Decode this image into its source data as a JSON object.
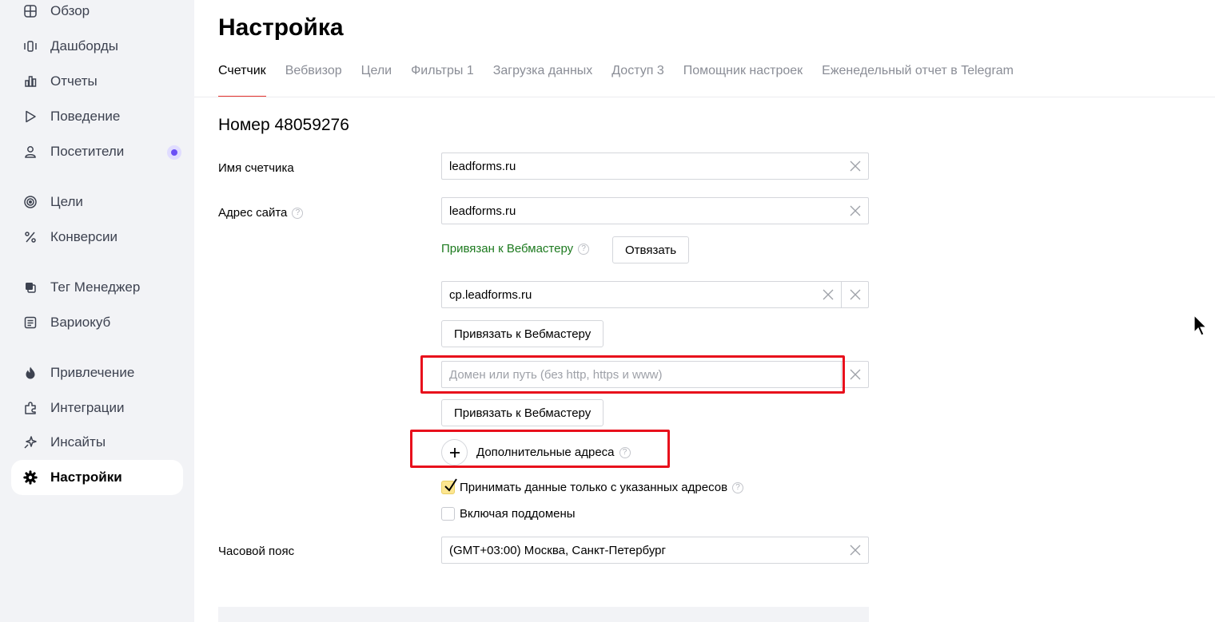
{
  "sidebar": {
    "items": [
      {
        "label": "Обзор",
        "icon": "grid-icon"
      },
      {
        "label": "Дашборды",
        "icon": "dashboards-icon"
      },
      {
        "label": "Отчеты",
        "icon": "bar-chart-icon"
      },
      {
        "label": "Поведение",
        "icon": "play-icon"
      },
      {
        "label": "Посетители",
        "icon": "person-icon"
      },
      {
        "label": "Цели",
        "icon": "target-icon"
      },
      {
        "label": "Конверсии",
        "icon": "percent-icon"
      },
      {
        "label": "Тег Менеджер",
        "icon": "tag-manager-icon"
      },
      {
        "label": "Вариокуб",
        "icon": "variocube-icon"
      },
      {
        "label": "Привлечение",
        "icon": "flame-icon"
      },
      {
        "label": "Интеграции",
        "icon": "puzzle-icon"
      },
      {
        "label": "Инсайты",
        "icon": "sparkle-icon"
      },
      {
        "label": "Настройки",
        "icon": "gear-icon",
        "active": true
      }
    ]
  },
  "page": {
    "title": "Настройка"
  },
  "tabs": [
    "Счетчик",
    "Вебвизор",
    "Цели",
    "Фильтры 1",
    "Загрузка данных",
    "Доступ 3",
    "Помощник настроек",
    "Еженедельный отчет в Telegram"
  ],
  "counter": {
    "title": "Номер 48059276",
    "name_label": "Имя счетчика",
    "name_value": "leadforms.ru",
    "site_label": "Адрес сайта",
    "site_value": "leadforms.ru",
    "webmaster_status": "Привязан к Вебмастеру",
    "unlink_button": "Отвязать",
    "extra_site_value": "cp.leadforms.ru",
    "link_webmaster_button": "Привязать к Вебмастеру",
    "domain_placeholder": "Домен или путь (без http, https и www)",
    "add_addresses_label": "Дополнительные адреса",
    "only_specified_label": "Принимать данные только с указанных адресов",
    "include_subdomains_label": "Включая поддомены",
    "timezone_label": "Часовой пояс",
    "timezone_value": "(GMT+03:00) Москва, Санкт-Петербург"
  },
  "colors": {
    "accent_red": "#e5322d",
    "highlight_red": "#e8101c",
    "linked_green": "#1d7a1f",
    "checkbox_yellow": "#fde690"
  }
}
